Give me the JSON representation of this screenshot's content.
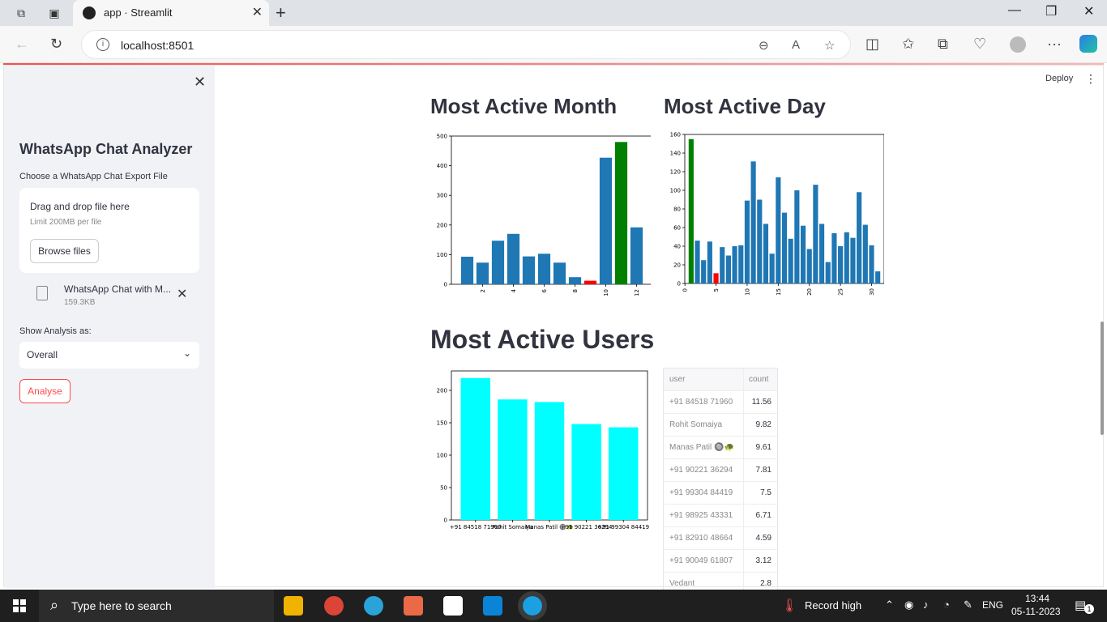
{
  "browser": {
    "tab_title": "app · Streamlit",
    "url": "localhost:8501"
  },
  "sidebar": {
    "title": "WhatsApp Chat Analyzer",
    "uploader_label": "Choose a WhatsApp Chat Export File",
    "dropzone_text": "Drag and drop file here",
    "dropzone_limit": "Limit 200MB per file",
    "browse_label": "Browse files",
    "file_name": "WhatsApp Chat with M...",
    "file_size": "159.3KB",
    "select_label": "Show Analysis as:",
    "select_value": "Overall",
    "analyse_label": "Analyse"
  },
  "header": {
    "deploy_label": "Deploy"
  },
  "sections": {
    "month_title": "Most Active Month",
    "day_title": "Most Active Day",
    "users_title": "Most Active Users"
  },
  "chart_data": [
    {
      "type": "bar",
      "x": [
        1,
        2,
        3,
        4,
        5,
        6,
        7,
        8,
        9,
        10,
        11,
        12
      ],
      "values": [
        93,
        73,
        147,
        170,
        94,
        103,
        73,
        24,
        12,
        427,
        480,
        192
      ],
      "highlight": {
        "max": 11,
        "min": 9
      },
      "colors": {
        "default": "#1f77b4",
        "max": "#008000",
        "min": "#ff0000"
      },
      "xticks": [
        "2",
        "4",
        "6",
        "8",
        "10",
        "12"
      ],
      "yticks": [
        "0",
        "100",
        "200",
        "300",
        "400",
        "500"
      ],
      "ylim": [
        0,
        500
      ]
    },
    {
      "type": "bar",
      "x": [
        1,
        2,
        3,
        4,
        5,
        6,
        7,
        8,
        9,
        10,
        11,
        12,
        13,
        14,
        15,
        16,
        17,
        18,
        19,
        20,
        21,
        22,
        23,
        24,
        25,
        26,
        27,
        28,
        29,
        30,
        31
      ],
      "values": [
        155,
        46,
        25,
        45,
        11,
        39,
        30,
        40,
        41,
        89,
        131,
        90,
        64,
        32,
        114,
        76,
        48,
        100,
        62,
        37,
        106,
        64,
        23,
        54,
        40,
        55,
        49,
        98,
        63,
        41,
        13
      ],
      "highlight": {
        "max": 1,
        "min": 5
      },
      "colors": {
        "default": "#1f77b4",
        "max": "#008000",
        "min": "#ff0000"
      },
      "xticks": [
        "0",
        "5",
        "10",
        "15",
        "20",
        "25",
        "30"
      ],
      "yticks": [
        "0",
        "20",
        "40",
        "60",
        "80",
        "100",
        "120",
        "140",
        "160"
      ],
      "ylim": [
        0,
        160
      ]
    },
    {
      "type": "bar",
      "categories": [
        "+91 84518 71960",
        "Rohit Somaiya",
        "Manas Patil 🔘🐢",
        "+91 90221 36294",
        "+91 99304 84419"
      ],
      "values": [
        219,
        186,
        182,
        148,
        143
      ],
      "color": "#00ffff",
      "yticks": [
        "0",
        "50",
        "100",
        "150",
        "200"
      ],
      "ylim": [
        0,
        230
      ]
    }
  ],
  "users_table": {
    "headers": [
      "user",
      "count"
    ],
    "rows": [
      [
        "+91 84518 71960",
        "11.56"
      ],
      [
        "Rohit Somaiya",
        "9.82"
      ],
      [
        "Manas Patil 🔘🐢",
        "9.61"
      ],
      [
        "+91 90221 36294",
        "7.81"
      ],
      [
        "+91 99304 84419",
        "7.5"
      ],
      [
        "+91 98925 43331",
        "6.71"
      ],
      [
        "+91 82910 48664",
        "4.59"
      ],
      [
        "+91 90049 61807",
        "3.12"
      ],
      [
        "Vedant",
        "2.8"
      ]
    ]
  },
  "taskbar": {
    "search_placeholder": "Type here to search",
    "weather": "Record high",
    "lang": "ENG",
    "time": "13:44",
    "date": "05-11-2023",
    "notif_count": "1"
  }
}
